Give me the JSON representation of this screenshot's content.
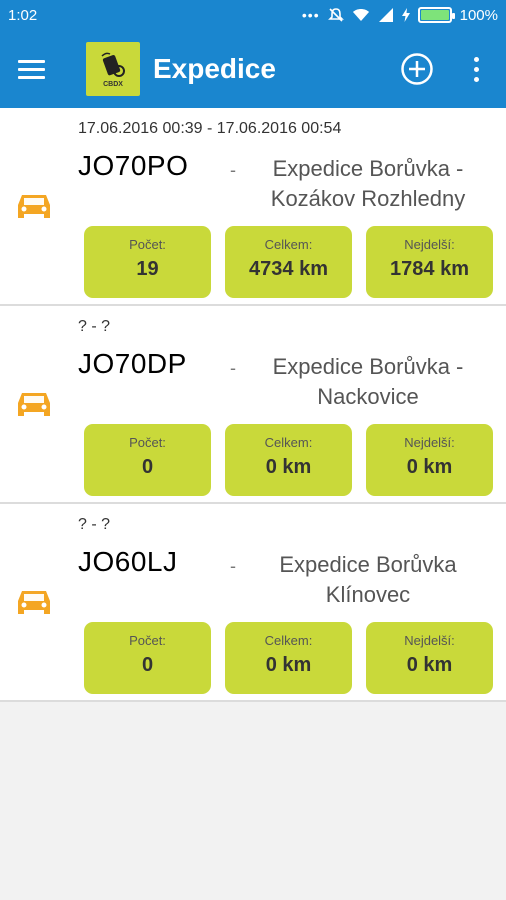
{
  "status": {
    "time": "1:02",
    "battery": "100%",
    "battery_level": 1.0
  },
  "appbar": {
    "title": "Expedice",
    "logo_text": "CBDX"
  },
  "cards": [
    {
      "date": "17.06.2016 00:39 - 17.06.2016 00:54",
      "plate": "JO70PO",
      "dash": "-",
      "route_line1": "Expedice Borůvka -",
      "route_line2": "Kozákov Rozhledny",
      "stats": [
        {
          "label": "Počet:",
          "value": "19"
        },
        {
          "label": "Celkem:",
          "value": "4734 km"
        },
        {
          "label": "Nejdelší:",
          "value": "1784 km"
        }
      ]
    },
    {
      "date": "? - ?",
      "plate": "JO70DP",
      "dash": "-",
      "route_line1": "Expedice Borůvka -",
      "route_line2": "Nackovice",
      "stats": [
        {
          "label": "Počet:",
          "value": "0"
        },
        {
          "label": "Celkem:",
          "value": "0 km"
        },
        {
          "label": "Nejdelší:",
          "value": "0 km"
        }
      ]
    },
    {
      "date": "? - ?",
      "plate": "JO60LJ",
      "dash": "-",
      "route_line1": "Expedice Borůvka",
      "route_line2": "Klínovec",
      "stats": [
        {
          "label": "Počet:",
          "value": "0"
        },
        {
          "label": "Celkem:",
          "value": "0 km"
        },
        {
          "label": "Nejdelší:",
          "value": "0 km"
        }
      ]
    }
  ],
  "colors": {
    "appbar": "#1a86cf",
    "accent": "#c9d93a",
    "car": "#f4a623"
  },
  "icons": [
    "menu-icon",
    "app-logo-icon",
    "add-circle-icon",
    "more-vert-icon",
    "car-icon",
    "signal-icon",
    "wifi-icon",
    "mute-icon",
    "charging-icon",
    "battery-icon"
  ]
}
